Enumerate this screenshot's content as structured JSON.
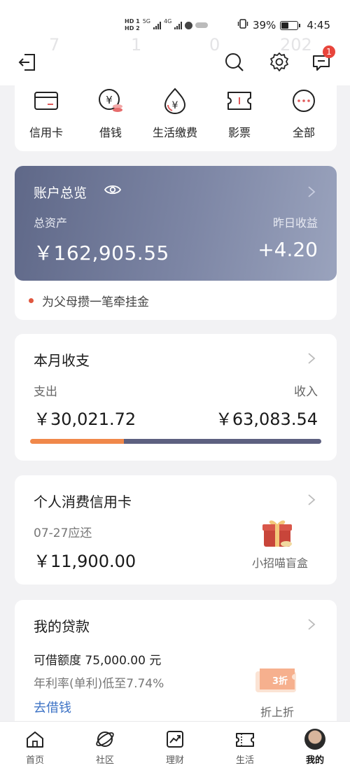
{
  "status_bar": {
    "network_a": "HD 1",
    "network_b": "HD 2",
    "gen_a": "5G",
    "gen_b": "4G",
    "battery_percent": "39%",
    "battery_level": 0.39,
    "time": "4:45"
  },
  "background_numbers": [
    "7",
    "1",
    "0",
    "202"
  ],
  "header": {
    "notification_count": "1"
  },
  "quick_actions": [
    {
      "label": "信用卡",
      "icon": "credit-card-icon"
    },
    {
      "label": "借钱",
      "icon": "borrow-money-icon"
    },
    {
      "label": "生活缴费",
      "icon": "bill-payment-icon"
    },
    {
      "label": "影票",
      "icon": "movie-ticket-icon"
    },
    {
      "label": "全部",
      "icon": "more-icon"
    }
  ],
  "overview": {
    "title": "账户总览",
    "total_assets_label": "总资产",
    "total_assets_value": "￥162,905.55",
    "yesterday_income_label": "昨日收益",
    "yesterday_income_value": "+4.20",
    "tip": "为父母攒一笔牵挂金"
  },
  "monthly": {
    "title": "本月收支",
    "expense_label": "支出",
    "expense_value": "￥30,021.72",
    "income_label": "收入",
    "income_value": "￥63,083.54",
    "expense_amount": 30021.72,
    "income_amount": 63083.54
  },
  "credit": {
    "title": "个人消费信用卡",
    "due_label": "07-27应还",
    "due_value": "￥11,900.00",
    "promo_label": "小招喵盲盒"
  },
  "loan": {
    "title": "我的贷款",
    "limit_text": "可借额度 75,000.00 元",
    "rate_text": "年利率(单利)低至7.74%",
    "link_text": "去借钱",
    "coupon_text": "3折",
    "promo_label": "折上折"
  },
  "bottom_nav": [
    {
      "label": "首页",
      "icon": "home-icon"
    },
    {
      "label": "社区",
      "icon": "community-icon"
    },
    {
      "label": "理财",
      "icon": "wealth-chart-icon"
    },
    {
      "label": "生活",
      "icon": "life-ticket-icon"
    },
    {
      "label": "我的",
      "icon": "avatar"
    }
  ],
  "colors": {
    "accent_orange": "#f0884a",
    "income_bar": "#5d6080",
    "link_blue": "#3f74c6",
    "badge_red": "#e8453c"
  }
}
